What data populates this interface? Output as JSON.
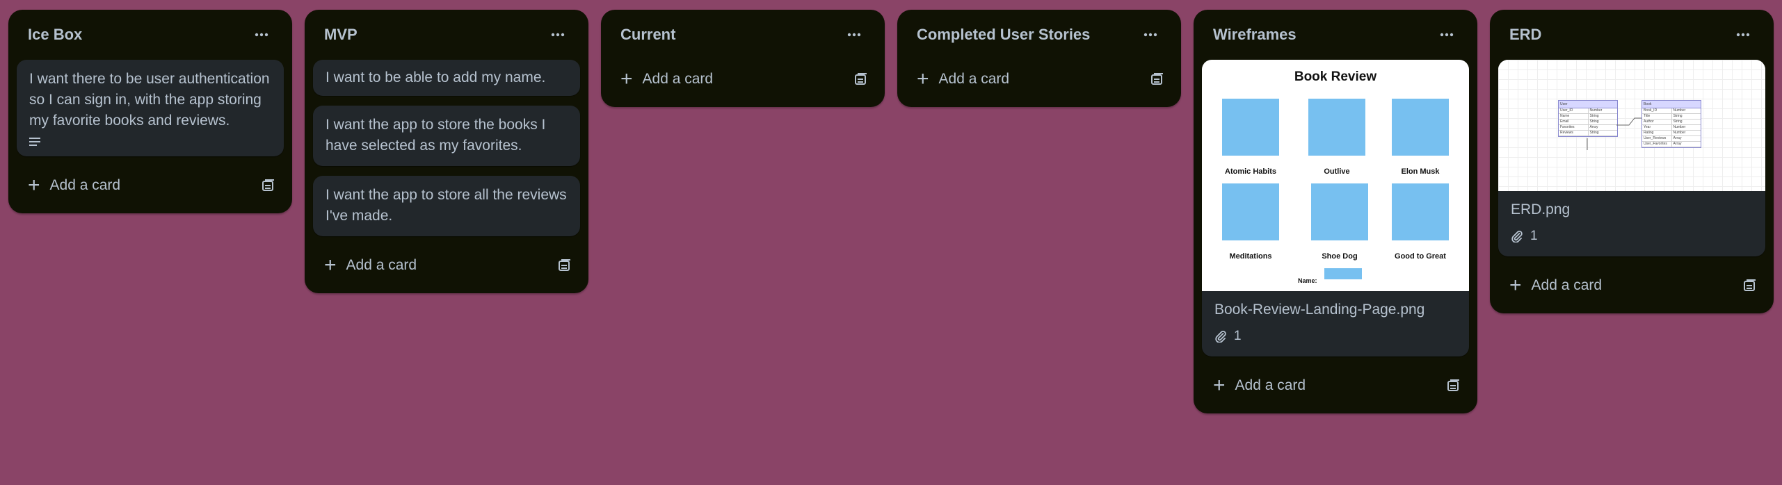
{
  "board": {
    "background": "#8a4467"
  },
  "lists": [
    {
      "title": "Ice Box",
      "cards": [
        "I want there to be user authentication so I can sign in, with the app storing my favorite books and reviews."
      ],
      "add_label": "Add a card"
    },
    {
      "title": "MVP",
      "cards": [
        "I want to be able to add my name.",
        "I want the app to store the books I have selected as my favorites.",
        "I want the app to store all the reviews I've made."
      ],
      "add_label": "Add a card"
    },
    {
      "title": "Current",
      "cards": [],
      "add_label": "Add a card"
    },
    {
      "title": "Completed User Stories",
      "cards": [],
      "add_label": "Add a card"
    },
    {
      "title": "Wireframes",
      "add_label": "Add a card",
      "image_card": {
        "filename": "Book-Review-Landing-Page.png",
        "attachments": "1",
        "preview": {
          "title": "Book Review",
          "books": [
            "Atomic Habits",
            "Outlive",
            "Elon Musk",
            "Meditations",
            "Shoe Dog",
            "Good to Great"
          ],
          "name_label": "Name:"
        }
      }
    },
    {
      "title": "ERD",
      "add_label": "Add a card",
      "image_card": {
        "filename": "ERD.png",
        "attachments": "1",
        "preview": {
          "user_table": {
            "title": "User",
            "rows": [
              [
                "User_ID",
                "Number"
              ],
              [
                "Name",
                "String"
              ],
              [
                "Email",
                "String"
              ],
              [
                "Favorites",
                "Array"
              ],
              [
                "Reviews",
                "String"
              ]
            ]
          },
          "book_table": {
            "title": "Book",
            "rows": [
              [
                "Book_ID",
                "Number"
              ],
              [
                "Title",
                "String"
              ],
              [
                "Author",
                "String"
              ],
              [
                "Year",
                "Number"
              ],
              [
                "Rating",
                "Number"
              ],
              [
                "User_Reviews",
                "Array"
              ],
              [
                "User_Favorites",
                "Array"
              ]
            ]
          }
        }
      }
    }
  ],
  "icons": {
    "menu": "ellipsis-icon",
    "add": "plus-icon",
    "template": "card-template-icon",
    "description": "description-icon",
    "attachment": "paperclip-icon"
  }
}
